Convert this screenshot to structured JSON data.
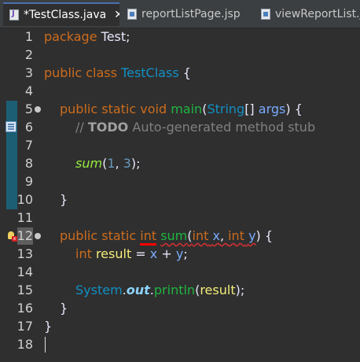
{
  "tabs": [
    {
      "label": "*TestClass.java",
      "icon": "java-file-icon",
      "active": true,
      "close": "✕"
    },
    {
      "label": "reportListPage.jsp",
      "icon": "jsp-file-icon",
      "active": false
    },
    {
      "label": "viewReportList.js",
      "icon": "jsp-file-icon",
      "active": false
    }
  ],
  "line_numbers": [
    "1",
    "2",
    "3",
    "4",
    "5",
    "6",
    "7",
    "8",
    "9",
    "10",
    "11",
    "12",
    "13",
    "14",
    "15",
    "16",
    "17",
    "18"
  ],
  "code": {
    "l1": {
      "kw": "package",
      "rest": " Test;"
    },
    "l3": {
      "kw": "public class",
      "cls": "TestClass",
      "rest": " {"
    },
    "l5": {
      "kw": "public static void",
      "mth": "main",
      "open": "(",
      "type": "String",
      "arr": "[] ",
      "param": "args",
      "close": ") {"
    },
    "l6": {
      "comment_prefix": "// ",
      "todo": "TODO",
      "comment_rest": " Auto-generated method stub"
    },
    "l8": {
      "call": "sum",
      "open": "(",
      "n1": "1",
      "comma": ", ",
      "n2": "3",
      "close": ");"
    },
    "l10": {
      "text": "}"
    },
    "l12": {
      "kw": "public static",
      "ret": "int",
      "mth": "sum",
      "open": "(",
      "t1": "int",
      "p1": "x",
      "comma": ", ",
      "t2": "int",
      "p2": "y",
      "close": ") {"
    },
    "l13": {
      "kw": "int",
      "local": "result",
      "eq": " = ",
      "x": "x",
      "plus": " + ",
      "y": "y",
      "semi": ";"
    },
    "l15": {
      "cls": "System",
      "dot1": ".",
      "field": "out",
      "dot2": ".",
      "mth": "println",
      "open": "(",
      "arg": "result",
      "close": ");"
    },
    "l16": {
      "text": "}"
    },
    "l17": {
      "text": "}"
    }
  }
}
